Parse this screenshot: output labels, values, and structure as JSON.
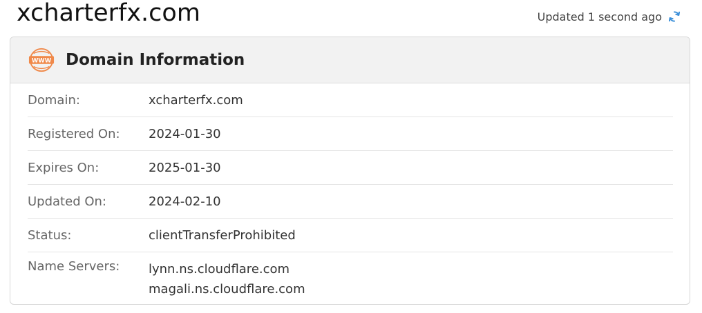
{
  "page": {
    "title": "xcharterfx.com",
    "updated_text": "Updated 1 second ago"
  },
  "card": {
    "title": "Domain Information",
    "icon": "www-icon",
    "rows": [
      {
        "label": "Domain:",
        "value": "xcharterfx.com"
      },
      {
        "label": "Registered On:",
        "value": "2024-01-30"
      },
      {
        "label": "Expires On:",
        "value": "2025-01-30"
      },
      {
        "label": "Updated On:",
        "value": "2024-02-10"
      },
      {
        "label": "Status:",
        "value": "clientTransferProhibited"
      }
    ],
    "name_servers": {
      "label": "Name Servers:",
      "values": [
        "lynn.ns.cloudflare.com",
        "magali.ns.cloudflare.com"
      ]
    }
  },
  "colors": {
    "icon_orange": "#f0894a",
    "refresh_blue": "#3b8fd9"
  }
}
